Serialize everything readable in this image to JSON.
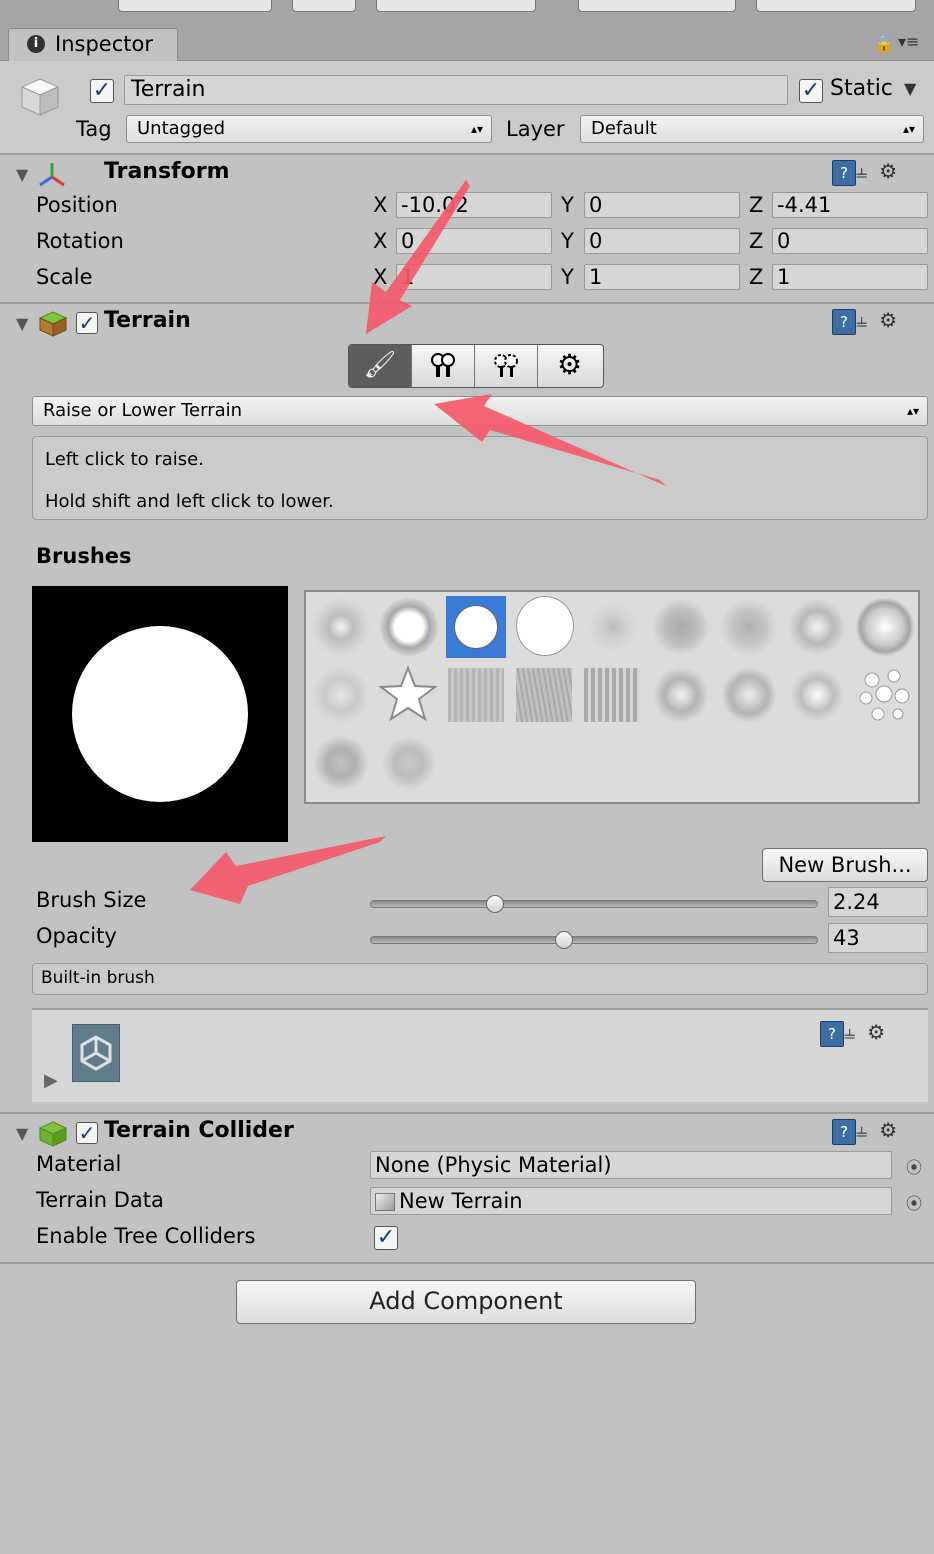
{
  "tab": {
    "label": "Inspector"
  },
  "header": {
    "name": "Terrain",
    "static_label": "Static",
    "tag_label": "Tag",
    "tag_value": "Untagged",
    "layer_label": "Layer",
    "layer_value": "Default"
  },
  "transform": {
    "title": "Transform",
    "rows": [
      {
        "label": "Position",
        "x": "-10.02",
        "y": "0",
        "z": "-4.41"
      },
      {
        "label": "Rotation",
        "x": "0",
        "y": "0",
        "z": "0"
      },
      {
        "label": "Scale",
        "x": "1",
        "y": "1",
        "z": "1"
      }
    ],
    "axis_x": "X",
    "axis_y": "Y",
    "axis_z": "Z"
  },
  "terrain": {
    "title": "Terrain",
    "tool_icons": [
      "paintbrush-icon",
      "tree-icon",
      "grass-detail-icon",
      "gear-icon"
    ],
    "tool_dropdown": "Raise or Lower Terrain",
    "help_line1": "Left click to raise.",
    "help_line2": "Hold shift and left click to lower.",
    "brushes_label": "Brushes",
    "new_brush_button": "New Brush...",
    "brush_size_label": "Brush Size",
    "brush_size_value": "2.24",
    "brush_size_fraction": 0.28,
    "opacity_label": "Opacity",
    "opacity_value": "43",
    "opacity_fraction": 0.43,
    "builtin_label": "Built-in brush",
    "selected_brush_index": 2
  },
  "collider": {
    "title": "Terrain Collider",
    "material_label": "Material",
    "material_value": "None (Physic Material)",
    "terrain_data_label": "Terrain Data",
    "terrain_data_value": "New Terrain",
    "tree_colliders_label": "Enable Tree Colliders"
  },
  "add_component_button": "Add Component",
  "colors": {
    "panel_bg": "#c2c2c2",
    "selected_brush": "#3a7bd5",
    "annotation_arrow": "#f45a6a"
  }
}
